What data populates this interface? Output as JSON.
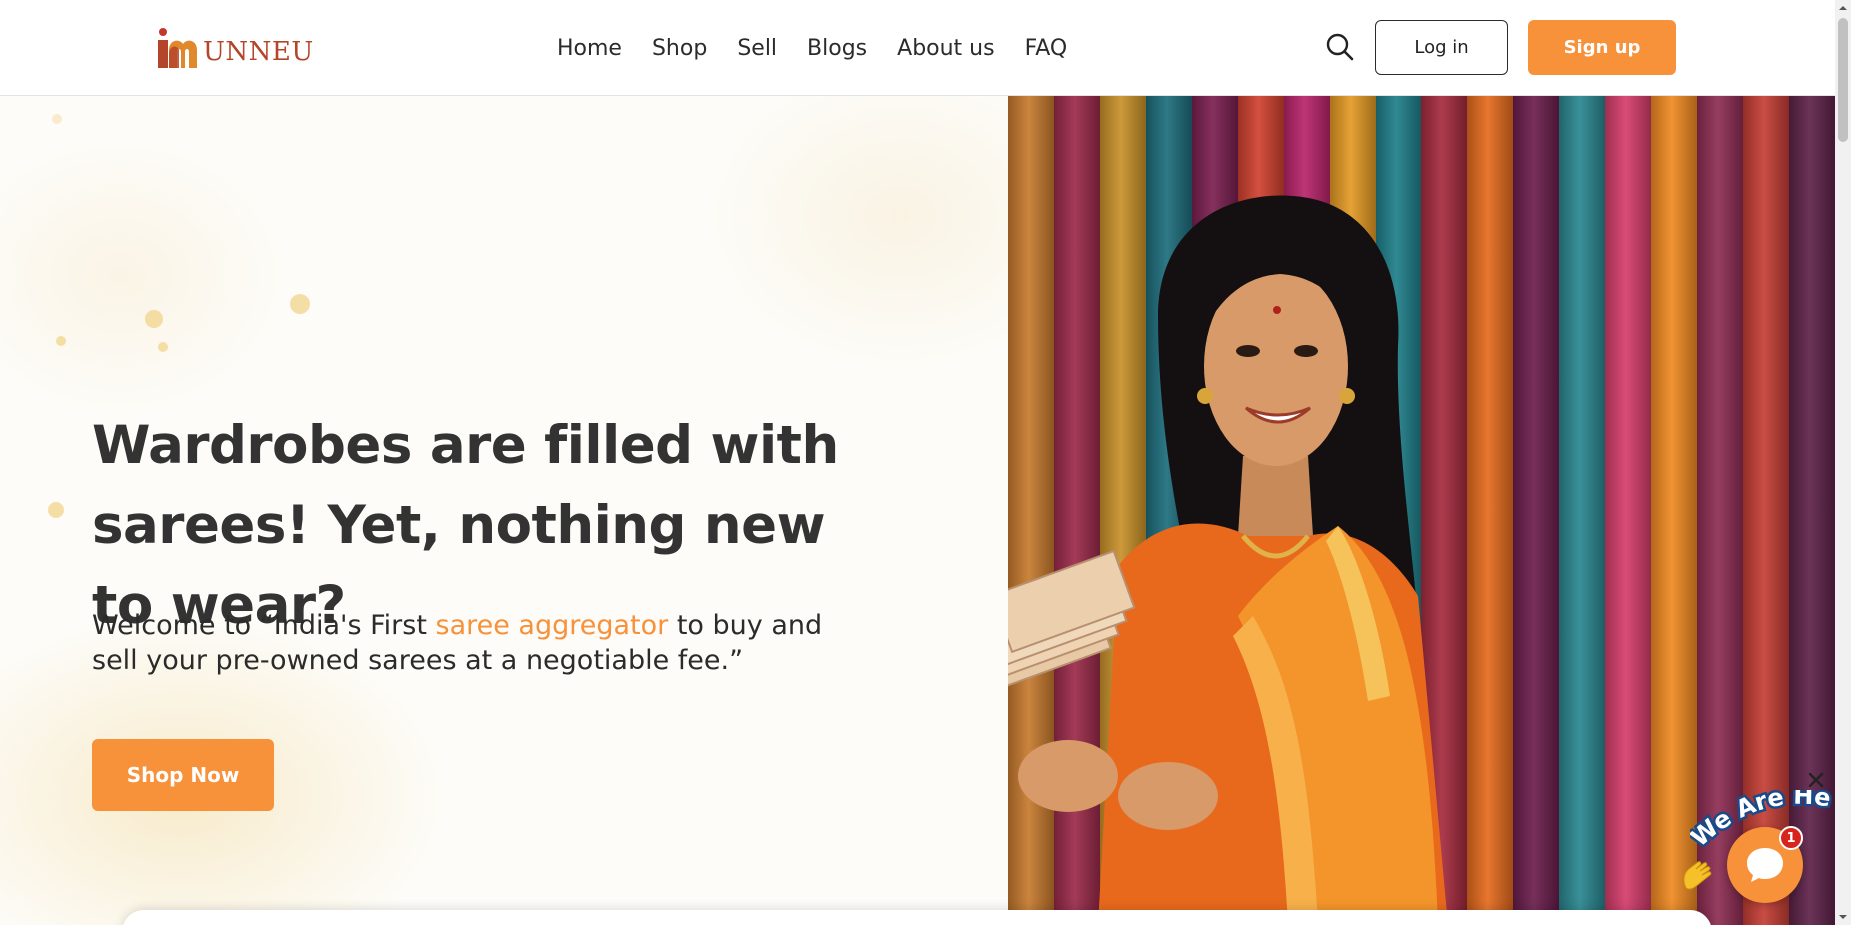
{
  "brand": {
    "name": "UNNEU",
    "accent_color": "#f7913a",
    "logo_color": "#b5452a"
  },
  "nav": {
    "items": [
      {
        "label": "Home"
      },
      {
        "label": "Shop"
      },
      {
        "label": "Sell"
      },
      {
        "label": "Blogs"
      },
      {
        "label": "About us"
      },
      {
        "label": "FAQ"
      }
    ]
  },
  "header": {
    "search_icon": "search-icon",
    "login_label": "Log in",
    "signup_label": "Sign up"
  },
  "hero": {
    "headline": "Wardrobes are filled with sarees! Yet, nothing new to wear?",
    "sub_before": "Welcome to “India's First ",
    "sub_highlight": "saree aggregator",
    "sub_after": " to buy and sell your pre-owned sarees at a negotiable fee.”",
    "cta_label": "Shop Now",
    "image": "woman-in-orange-saree-holding-banknotes",
    "drape_colors": [
      "#c77a2e",
      "#9b2a4a",
      "#c8912a",
      "#1d6d7c",
      "#7a1f50",
      "#d0412f",
      "#b8246a",
      "#e39a24",
      "#1f7f8a",
      "#a52b3f",
      "#e56b1e",
      "#6b1e4c",
      "#2a8790",
      "#d53d6b",
      "#f08a22",
      "#8e2d52",
      "#c43e35",
      "#5e2249"
    ]
  },
  "chat": {
    "badge_text": "We Are Here!",
    "unread_count": "1",
    "chat_icon": "chat-bubble-icon",
    "close_icon": "close-icon",
    "wave_icon": "waving-hand-icon"
  }
}
